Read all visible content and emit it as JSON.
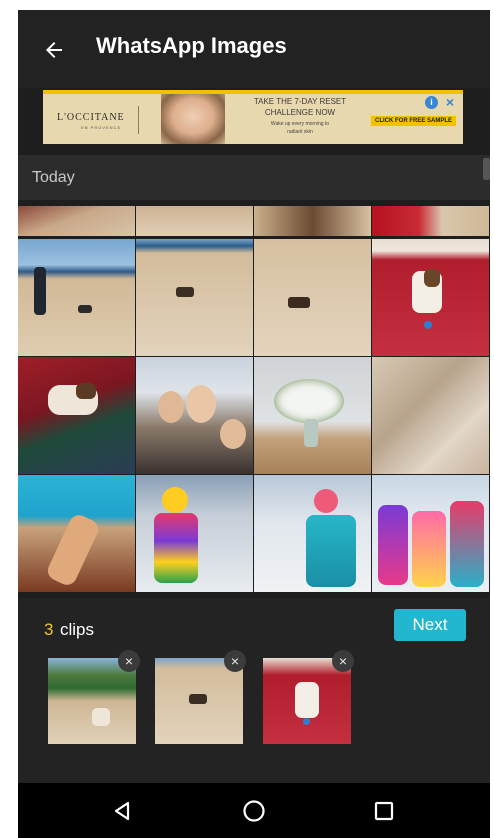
{
  "header": {
    "title": "WhatsApp Images",
    "back_icon": "arrow-left-icon"
  },
  "ad": {
    "brand": "L'OCCITANE",
    "brand_sub": "EN PROVENCE",
    "headline_1": "TAKE THE 7-DAY RESET",
    "headline_2": "CHALLENGE NOW",
    "sub_1": "Wake up every morning to",
    "sub_2": "radiant skin",
    "cta": "CLICK FOR FREE SAMPLE",
    "info_icon": "i",
    "close_icon": "×",
    "accent_color": "#f2c200"
  },
  "section": {
    "title": "Today"
  },
  "clips": {
    "count": "3",
    "label": " clips",
    "next_label": "Next",
    "count_color": "#f2c230",
    "next_color": "#22b7cf",
    "remove_icon": "×"
  },
  "navbar": {
    "back_icon": "triangle-back-icon",
    "home_icon": "circle-home-icon",
    "recents_icon": "square-recents-icon"
  }
}
